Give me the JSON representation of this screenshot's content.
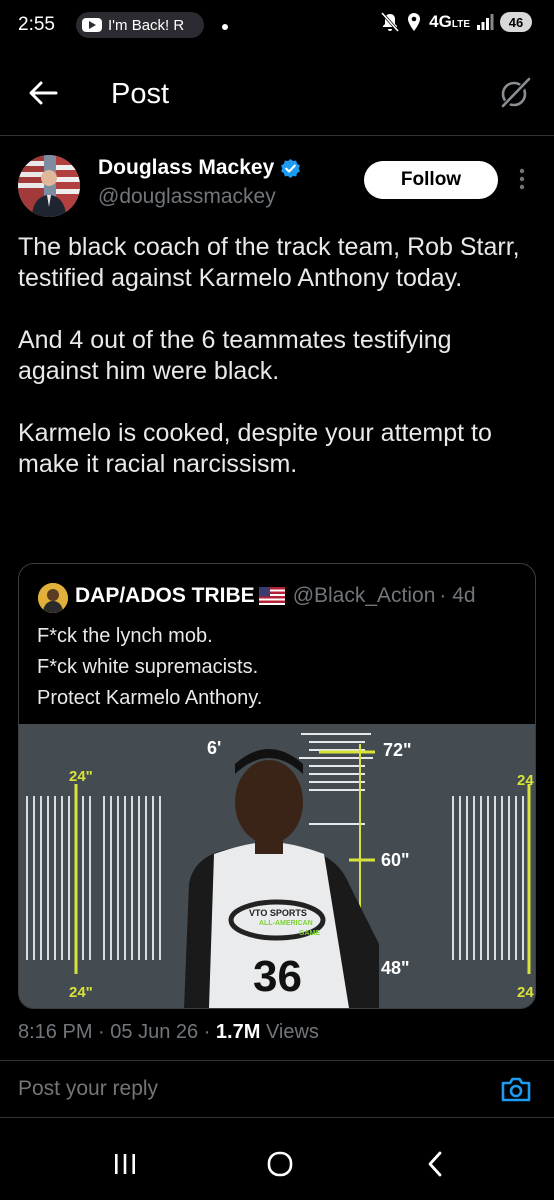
{
  "status_bar": {
    "time": "2:55",
    "notification_text": "I'm Back! R",
    "network": "4G",
    "network_sub": "LTE",
    "battery": "46"
  },
  "header": {
    "title": "Post"
  },
  "author": {
    "name": "Douglass Mackey",
    "handle": "@douglassmackey",
    "follow_label": "Follow"
  },
  "post": {
    "paragraphs": [
      "The black coach of the track team, Rob Starr, testified against Karmelo Anthony today.",
      "And 4 out of the 6 teammates testifying against him were black.",
      "Karmelo is cooked, despite your attempt to make it racial narcissism."
    ]
  },
  "quote": {
    "name": "DAP/ADOS TRIBE",
    "handle": "@Black_Action",
    "age": "· 4d",
    "lines": [
      "F*ck the lynch mob.",
      "F*ck white supremacists.",
      "Protect Karmelo Anthony."
    ],
    "image_text": {
      "height_6ft": "6'",
      "height_72": "72\"",
      "height_60": "60\"",
      "height_48": "48\"",
      "left_top": "24\"",
      "left_bottom": "24\"",
      "right_top": "24",
      "right_bottom": "24",
      "shirt_line1": "VTO SPORTS",
      "shirt_line2": "ALL-AMERICAN",
      "shirt_line3": "GAME",
      "jersey_number": "36"
    }
  },
  "meta": {
    "time": "8:16 PM",
    "date": "05 Jun 26",
    "views_count": "1.7M",
    "views_label": "Views"
  },
  "reply": {
    "placeholder": "Post your reply"
  },
  "colors": {
    "background": "#000000",
    "secondary_text": "#71767b",
    "verified": "#1d9bf0",
    "camera": "#1d9bf0"
  }
}
